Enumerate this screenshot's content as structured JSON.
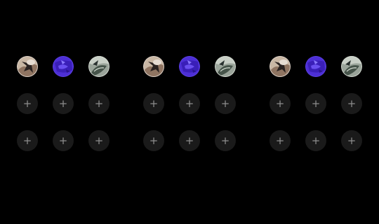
{
  "plus_glyph": "+",
  "accent_colors": {
    "background": "#000000",
    "slot_fill": "#1a1a1a",
    "plus_color": "#8e8e8e"
  },
  "panels": [
    {
      "avatars": [
        {
          "icon": "photo-avatar-warm"
        },
        {
          "icon": "photo-avatar-purple"
        },
        {
          "icon": "photo-avatar-leaf"
        }
      ],
      "empty_slot_rows": 2,
      "slots_per_row": 3
    },
    {
      "avatars": [
        {
          "icon": "photo-avatar-warm"
        },
        {
          "icon": "photo-avatar-purple"
        },
        {
          "icon": "photo-avatar-leaf"
        }
      ],
      "empty_slot_rows": 2,
      "slots_per_row": 3
    },
    {
      "avatars": [
        {
          "icon": "photo-avatar-warm"
        },
        {
          "icon": "photo-avatar-purple"
        },
        {
          "icon": "photo-avatar-leaf"
        }
      ],
      "empty_slot_rows": 2,
      "slots_per_row": 3
    }
  ]
}
